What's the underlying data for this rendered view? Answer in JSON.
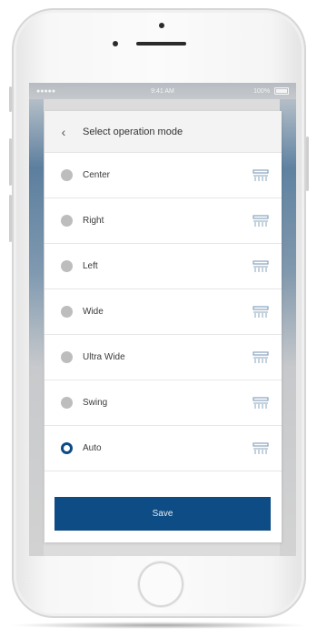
{
  "statusbar": {
    "carrier": "●●●●● ",
    "time": "9:41 AM",
    "battery": "100%"
  },
  "header": {
    "back_icon": "chevron-left-icon",
    "title": "Select operation mode"
  },
  "options": [
    {
      "label": "Center",
      "selected": false,
      "icon": "louver-center-icon"
    },
    {
      "label": "Right",
      "selected": false,
      "icon": "louver-right-icon"
    },
    {
      "label": "Left",
      "selected": false,
      "icon": "louver-left-icon"
    },
    {
      "label": "Wide",
      "selected": false,
      "icon": "louver-wide-icon"
    },
    {
      "label": "Ultra Wide",
      "selected": false,
      "icon": "louver-ultra-wide-icon"
    },
    {
      "label": "Swing",
      "selected": false,
      "icon": "louver-swing-icon"
    },
    {
      "label": "Auto",
      "selected": true,
      "icon": "louver-auto-icon"
    }
  ],
  "save_label": "Save",
  "colors": {
    "accent": "#0d4c85",
    "radio_unselected": "#bdbdbd",
    "icon": "#8aa4bd"
  }
}
